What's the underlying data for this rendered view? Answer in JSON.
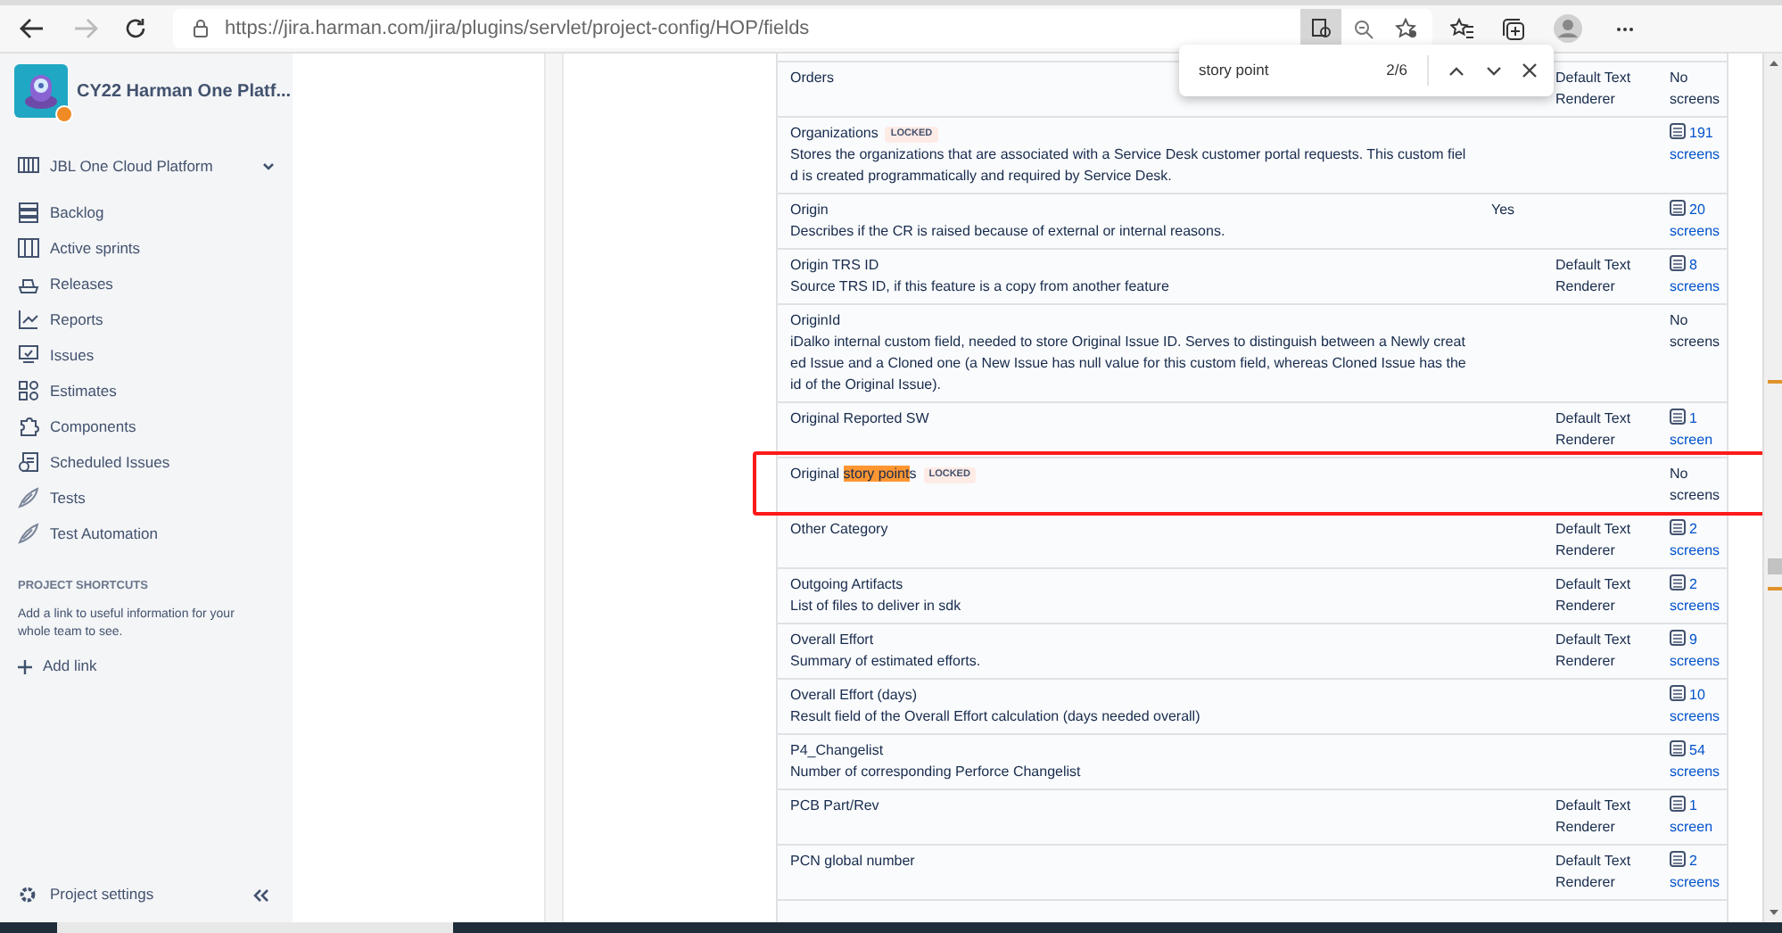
{
  "browser": {
    "url": "https://jira.harman.com/jira/plugins/servlet/project-config/HOP/fields",
    "find_bar": {
      "query": "story point",
      "count": "2/6"
    }
  },
  "sidebar": {
    "project_title": "CY22 Harman One Platf...",
    "board": "JBL One Cloud Platform",
    "items": [
      {
        "label": "Backlog"
      },
      {
        "label": "Active sprints"
      },
      {
        "label": "Releases"
      },
      {
        "label": "Reports"
      },
      {
        "label": "Issues"
      },
      {
        "label": "Estimates"
      },
      {
        "label": "Components"
      },
      {
        "label": "Scheduled Issues"
      },
      {
        "label": "Tests"
      },
      {
        "label": "Test Automation"
      }
    ],
    "shortcuts_heading": "PROJECT SHORTCUTS",
    "shortcuts_text": "Add a link to useful information for your whole team to see.",
    "add_link": "Add link",
    "settings": "Project settings"
  },
  "fields": [
    {
      "name": [
        {
          "text": "Orders",
          "match": false
        }
      ],
      "locked": false,
      "renderer": "Default Text Renderer",
      "screens": "No screens",
      "has_screens": false
    },
    {
      "name": [
        {
          "text": "Organizations",
          "match": false
        }
      ],
      "locked": true,
      "lock_label": "LOCKED",
      "description": "Stores the organizations that are associated with a Service Desk customer portal requests. This custom field is created programmatically and required by Service Desk.",
      "screens": "191 screens",
      "has_screens": true
    },
    {
      "name": [
        {
          "text": "Origin",
          "match": false
        }
      ],
      "locked": false,
      "description": "Describes if the CR is raised because of external or internal reasons.",
      "required": "Yes",
      "screens": "20 screens",
      "has_screens": true
    },
    {
      "name": [
        {
          "text": "Origin TRS ID",
          "match": false
        }
      ],
      "locked": false,
      "description": "Source TRS ID, if this feature is a copy from another feature",
      "renderer": "Default Text Renderer",
      "screens": "8 screens",
      "has_screens": true
    },
    {
      "name": [
        {
          "text": "OriginId",
          "match": false
        }
      ],
      "locked": false,
      "description": "iDalko internal custom field, needed to store Original Issue ID. Serves to distinguish between a Newly created Issue and a Cloned one (a New Issue has null value for this custom field, whereas Cloned Issue has the id of the Original Issue).",
      "screens": "No screens",
      "has_screens": false
    },
    {
      "name": [
        {
          "text": "Original Reported SW",
          "match": false
        }
      ],
      "locked": false,
      "renderer": "Default Text Renderer",
      "screens": "1 screen",
      "has_screens": true
    },
    {
      "name": [
        {
          "text": "Original ",
          "match": false
        },
        {
          "text": "story point",
          "match": true
        },
        {
          "text": "s",
          "match": false
        }
      ],
      "locked": true,
      "lock_label": "LOCKED",
      "screens": "No screens",
      "has_screens": false,
      "annotated": true
    },
    {
      "name": [
        {
          "text": "Other Category",
          "match": false
        }
      ],
      "locked": false,
      "renderer": "Default Text Renderer",
      "screens": "2 screens",
      "has_screens": true
    },
    {
      "name": [
        {
          "text": "Outgoing Artifacts",
          "match": false
        }
      ],
      "locked": false,
      "description": "List of files to deliver in sdk",
      "renderer": "Default Text Renderer",
      "screens": "2 screens",
      "has_screens": true
    },
    {
      "name": [
        {
          "text": "Overall Effort",
          "match": false
        }
      ],
      "locked": false,
      "description": "Summary of estimated efforts.",
      "renderer": "Default Text Renderer",
      "screens": "9 screens",
      "has_screens": true
    },
    {
      "name": [
        {
          "text": "Overall Effort (days)",
          "match": false
        }
      ],
      "locked": false,
      "description": "Result field of the Overall Effort calculation (days needed overall)",
      "screens": "10 screens",
      "has_screens": true
    },
    {
      "name": [
        {
          "text": "P4_Changelist",
          "match": false
        }
      ],
      "locked": false,
      "description": "Number of corresponding Perforce Changelist",
      "screens": "54 screens",
      "has_screens": true
    },
    {
      "name": [
        {
          "text": "PCB Part/Rev",
          "match": false
        }
      ],
      "locked": false,
      "renderer": "Default Text Renderer",
      "screens": "1 screen",
      "has_screens": true
    },
    {
      "name": [
        {
          "text": "PCN global number",
          "match": false
        }
      ],
      "locked": false,
      "renderer": "Default Text Renderer",
      "screens": "2 screens",
      "has_screens": true
    }
  ]
}
